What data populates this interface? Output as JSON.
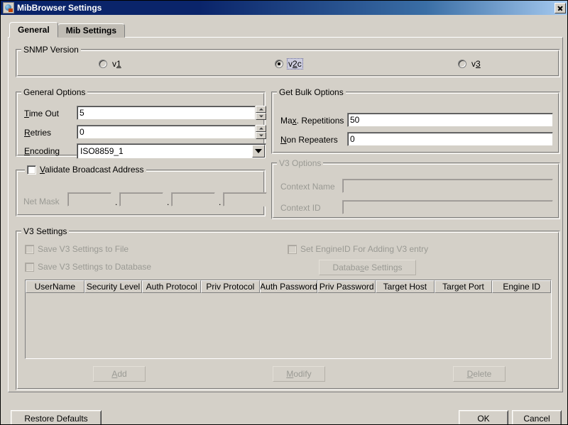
{
  "window": {
    "title": "MibBrowser Settings",
    "icon": "mibbrowser-icon",
    "close_label": "✕"
  },
  "tabs": [
    {
      "label": "General",
      "selected": true
    },
    {
      "label": "Mib Settings",
      "selected": false
    }
  ],
  "snmp_version": {
    "group_title": "SNMP Version",
    "options": [
      {
        "label": "v1",
        "mnemonic": "1",
        "selected": false
      },
      {
        "label": "v2c",
        "mnemonic": "2",
        "selected": true
      },
      {
        "label": "v3",
        "mnemonic": "3",
        "selected": false
      }
    ]
  },
  "general_options": {
    "group_title": "General Options",
    "timeout_label": "Time Out",
    "timeout_value": "5",
    "retries_label": "Retries",
    "retries_value": "0",
    "encoding_label": "Encoding",
    "encoding_value": "ISO8859_1"
  },
  "get_bulk_options": {
    "group_title": "Get Bulk Options",
    "max_repetitions_label": "Max. Repetitions",
    "max_repetitions_value": "50",
    "non_repeaters_label": "Non Repeaters",
    "non_repeaters_value": "0"
  },
  "validate_broadcast": {
    "checkbox_label": "Validate Broadcast Address",
    "checked": false,
    "netmask_label": "Net Mask",
    "netmask_octets": [
      "",
      "",
      "",
      ""
    ],
    "separator": "."
  },
  "v3_options": {
    "group_title": "V3 Options",
    "context_name_label": "Context Name",
    "context_name_value": "",
    "context_id_label": "Context ID",
    "context_id_value": "",
    "enabled": false
  },
  "v3_settings": {
    "group_title": "V3 Settings",
    "save_to_file_label": "Save V3 Settings to File",
    "save_to_file_checked": false,
    "save_to_db_label": "Save V3 Settings to Database",
    "save_to_db_checked": false,
    "set_engineid_label": "Set EngineID For Adding V3 entry",
    "set_engineid_checked": false,
    "database_settings_label": "Database Settings",
    "enabled": false,
    "table": {
      "columns": [
        "UserName",
        "Security Level",
        "Auth Protocol",
        "Priv Protocol",
        "Auth Password",
        "Priv Password",
        "Target Host",
        "Target Port",
        "Engine ID"
      ],
      "rows": []
    },
    "actions": [
      {
        "label": "Add",
        "enabled": false
      },
      {
        "label": "Modify",
        "enabled": false
      },
      {
        "label": "Delete",
        "enabled": false
      }
    ]
  },
  "footer": {
    "restore_defaults_label": "Restore Defaults",
    "ok_label": "OK",
    "cancel_label": "Cancel"
  },
  "colors": {
    "face": "#d4d0c8",
    "title_bar_start": "#0a246a",
    "title_bar_end": "#a6caf0",
    "disabled_text": "#9a9a94",
    "field_bg": "#ffffff",
    "focus_bg": "#ccccdd"
  }
}
